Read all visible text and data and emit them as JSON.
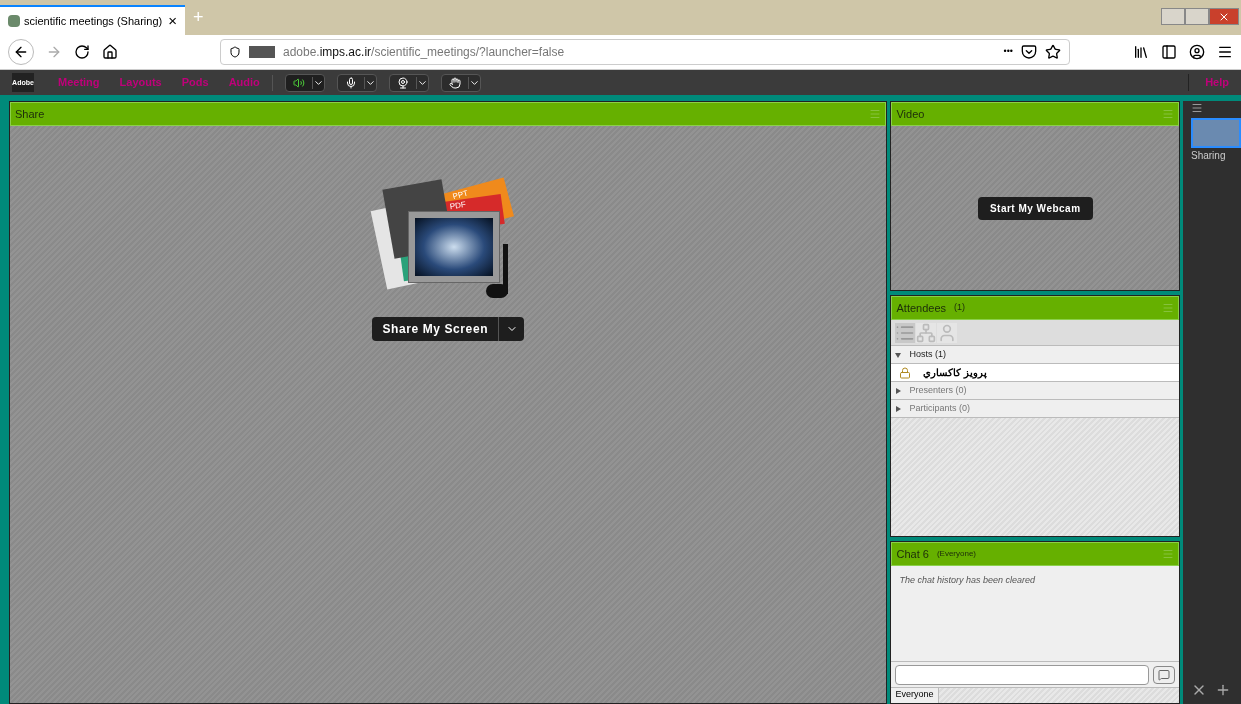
{
  "browser": {
    "tab_title": "scientific meetings (Sharing)",
    "tab_close": "×",
    "new_tab": "+",
    "url_sub": "adobe.",
    "url_host": "imps.ac.ir",
    "url_path": "/scientific_meetings/?launcher=false",
    "url_more": "•••"
  },
  "app": {
    "logo": "Adobe",
    "menu": [
      "Meeting",
      "Layouts",
      "Pods",
      "Audio"
    ],
    "help": "Help",
    "tools": [
      {
        "kind": "speaker",
        "on": true
      },
      {
        "kind": "mic",
        "on": false
      },
      {
        "kind": "webcam",
        "on": false
      },
      {
        "kind": "hand",
        "on": false
      }
    ]
  },
  "share_pod": {
    "title": "Share",
    "art_labels": [
      "PPT",
      "PDF"
    ],
    "button": "Share My Screen"
  },
  "video_pod": {
    "title": "Video",
    "button": "Start My Webcam"
  },
  "attendees_pod": {
    "title": "Attendees",
    "count": "(1)",
    "groups": [
      {
        "label": "Hosts (1)",
        "expanded": true,
        "children": [
          {
            "name": "پرویز کاکساري"
          }
        ]
      },
      {
        "label": "Presenters (0)",
        "expanded": false
      },
      {
        "label": "Participants (0)",
        "expanded": false
      }
    ]
  },
  "chat_pod": {
    "title": "Chat 6",
    "scope": "(Everyone)",
    "message": "The chat history has been cleared",
    "tab": "Everyone"
  },
  "layouts": [
    {
      "label": "Sharing",
      "selected": true
    }
  ]
}
